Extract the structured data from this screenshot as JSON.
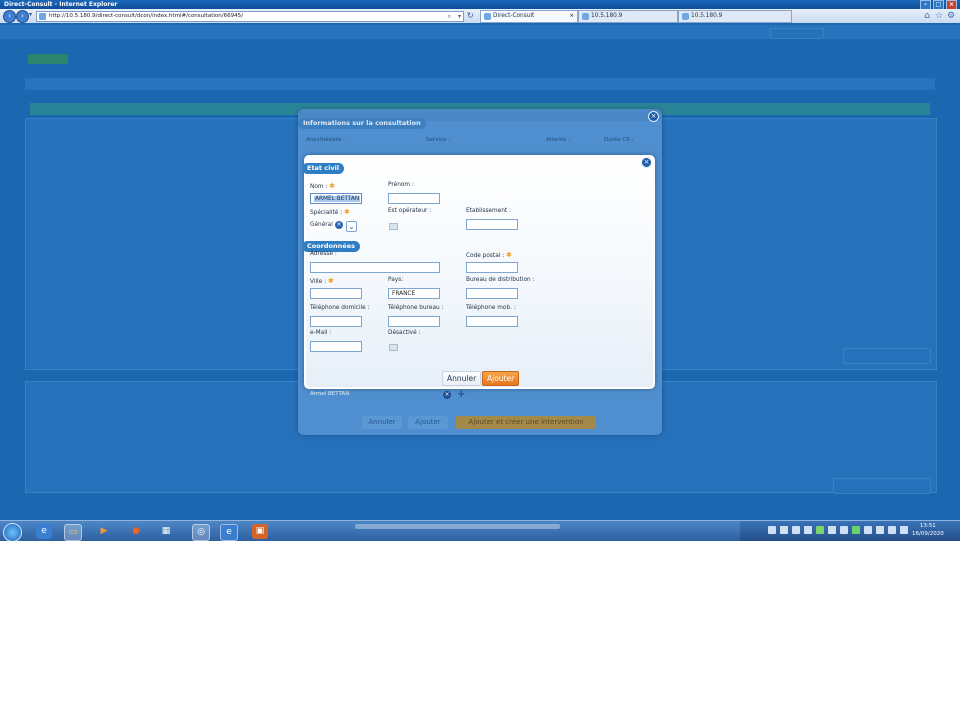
{
  "window": {
    "title": "Direct-Consult - Internet Explorer"
  },
  "browser": {
    "url": "http://10.5.180.9/direct-consult/dcon/index.html#/consultation/66945/",
    "tabs": [
      {
        "label": "Direct-Consult",
        "active": true
      },
      {
        "label": "10.5.180.9",
        "active": false
      },
      {
        "label": "10.5.180.9",
        "active": false
      }
    ]
  },
  "consultation_dialog": {
    "title": "Informations sur la consultation",
    "col_anesthesiste": "Anesthésiste :",
    "col_service": "Service :",
    "col_attente": "Attente :",
    "col_duree": "Durée CS :",
    "anesthesiste_value": "Armel BETTAN",
    "bottom_value": "Armel BETTAN",
    "buttons": {
      "annuler": "Annuler",
      "ajouter": "Ajouter",
      "ajouter_intervention": "Ajouter et créer une intervention"
    }
  },
  "person_dialog": {
    "section_etat_civil": "Etat civil",
    "section_coordonnees": "Coordonnées",
    "fields": {
      "nom_label": "Nom :",
      "nom_value": "ARMEL BETTAN",
      "prenom_label": "Prénom :",
      "prenom_value": "",
      "specialite_label": "Spécialité :",
      "specialite_value": "Général",
      "est_operateur_label": "Est opérateur :",
      "etablissement_label": "Etablissement :",
      "etablissement_value": "",
      "adresse_label": "Adresse :",
      "adresse_value": "",
      "code_postal_label": "Code postal :",
      "code_postal_value": "",
      "ville_label": "Ville :",
      "ville_value": "",
      "pays_label": "Pays:",
      "pays_value": "FRANCE",
      "bureau_distribution_label": "Bureau de distribution :",
      "bureau_distribution_value": "",
      "tel_domicile_label": "Téléphone domicile :",
      "tel_domicile_value": "",
      "tel_bureau_label": "Téléphone bureau :",
      "tel_bureau_value": "",
      "tel_mob_label": "Téléphone mob. :",
      "tel_mob_value": "",
      "email_label": "e-Mail :",
      "email_value": "",
      "desactive_label": "Désactivé :"
    },
    "required_marker": "✱",
    "buttons": {
      "annuler": "Annuler",
      "ajouter": "Ajouter"
    }
  },
  "taskbar": {
    "time": "13:51",
    "date": "16/09/2020"
  },
  "colors": {
    "accent": "#2e7ec3",
    "primary_button": "#e6761e",
    "required": "#f0a02a"
  },
  "icons": {
    "close": "×",
    "chevron": "⌄",
    "plus": "+"
  }
}
